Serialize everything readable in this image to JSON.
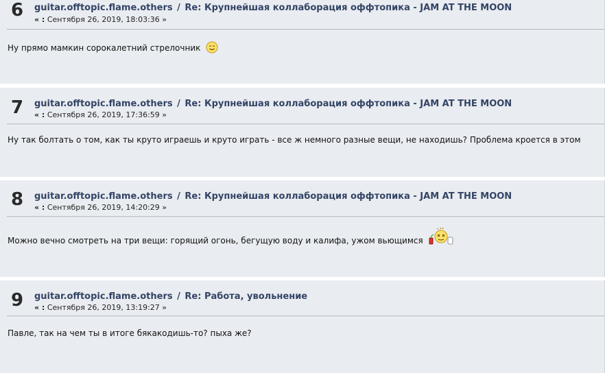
{
  "posts": [
    {
      "number": "6",
      "forum": "guitar.offtopic.flame.others",
      "separator": "/",
      "subject": "Re: Крупнейшая коллаборация оффтопика - JAM AT THE MOON",
      "date": "Сентября 26, 2019, 18:03:36",
      "text": "Ну прямо мамкин сорокалетний стрелочник",
      "emoji": "smiley-icon"
    },
    {
      "number": "7",
      "forum": "guitar.offtopic.flame.others",
      "separator": "/",
      "subject": "Re: Крупнейшая коллаборация оффтопика - JAM AT THE MOON",
      "date": "Сентября 26, 2019, 17:36:59",
      "text": "Ну так болтать о том, как ты круто играешь и круто играть - все ж немного разные вещи, не находишь? Проблема кроется в этом"
    },
    {
      "number": "8",
      "forum": "guitar.offtopic.flame.others",
      "separator": "/",
      "subject": "Re: Крупнейшая коллаборация оффтопика - JAM AT THE MOON",
      "date": "Сентября 26, 2019, 14:20:29",
      "text": "Можно вечно смотреть на три вещи: горящий огонь, бегущую воду и калифа, ужом вьющимся",
      "emoji": "dizzy-smiley-icon"
    },
    {
      "number": "9",
      "forum": "guitar.offtopic.flame.others",
      "separator": "/",
      "subject": "Re: Работа, увольнение",
      "date": "Сентября 26, 2019, 13:19:27",
      "text": "Павле, так на чем ты в итоге бякакодишь-то? пыха же?"
    }
  ],
  "meta_prefix": "« :",
  "meta_suffix": "»"
}
